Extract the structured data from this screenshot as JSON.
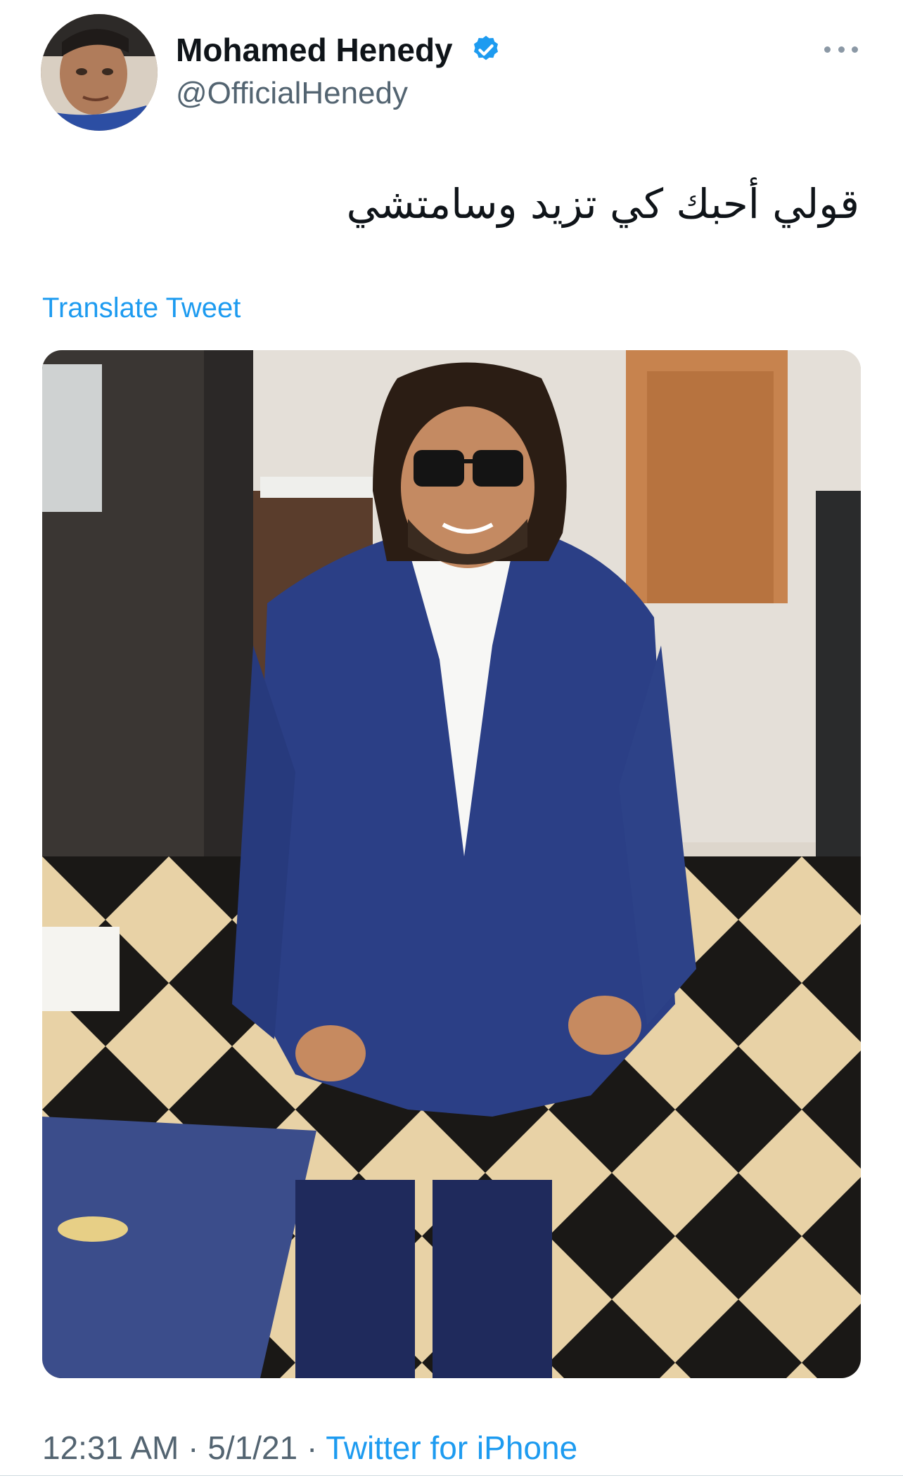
{
  "tweet": {
    "author": {
      "display_name": "Mohamed Henedy",
      "handle": "@OfficialHenedy",
      "verified": true,
      "avatar_icon": "profile-photo"
    },
    "text": "قولي أحبك كي تزيد وسامتشي",
    "translate_label": "Translate Tweet",
    "image": {
      "description_icon": "photo-man-in-blue-suit"
    },
    "time": "12:31 AM",
    "separator": "·",
    "date": "5/1/21",
    "source": "Twitter for iPhone",
    "more_icon": "more-horizontal-icon"
  },
  "colors": {
    "accent": "#1d9bf0",
    "secondary_text": "#536471",
    "primary_text": "#0f1419"
  }
}
